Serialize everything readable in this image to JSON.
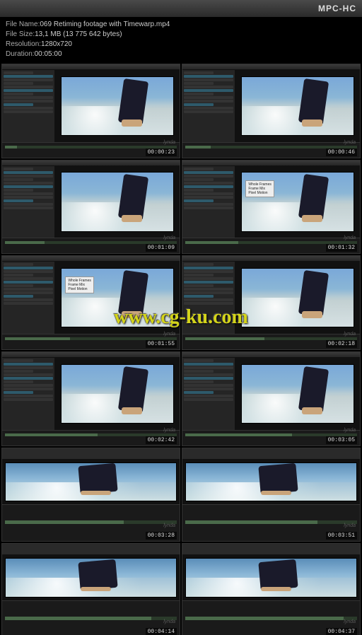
{
  "app_title": "MPC-HC",
  "file_info": {
    "name_label": "File Name: ",
    "name": "069 Retiming footage with Timewarp.mp4",
    "size_label": "File Size: ",
    "size": "13,1 MB (13 775 642 bytes)",
    "res_label": "Resolution: ",
    "res": "1280x720",
    "dur_label": "Duration: ",
    "dur": "00:05:00"
  },
  "watermark": "www.cg-ku.com",
  "lynda": "lynda",
  "popup_text": "Whole Frames\nFrame Mix\nPixel Motion",
  "thumbs": [
    {
      "tc": "00:00:23",
      "prog": 7,
      "layout": "split",
      "frame": 1,
      "popup": false
    },
    {
      "tc": "00:00:46",
      "prog": 15,
      "layout": "split",
      "frame": 1,
      "popup": false
    },
    {
      "tc": "00:01:09",
      "prog": 23,
      "layout": "split",
      "frame": 1,
      "popup": false
    },
    {
      "tc": "00:01:32",
      "prog": 31,
      "layout": "split",
      "frame": 1,
      "popup": true
    },
    {
      "tc": "00:01:55",
      "prog": 38,
      "layout": "split",
      "frame": 1,
      "popup": true
    },
    {
      "tc": "00:02:18",
      "prog": 46,
      "layout": "split",
      "frame": 1,
      "popup": false
    },
    {
      "tc": "00:02:42",
      "prog": 54,
      "layout": "split",
      "frame": 1,
      "popup": false
    },
    {
      "tc": "00:03:05",
      "prog": 62,
      "layout": "split",
      "frame": 1,
      "popup": false
    },
    {
      "tc": "00:03:28",
      "prog": 69,
      "layout": "full",
      "frame": 2,
      "popup": false
    },
    {
      "tc": "00:03:51",
      "prog": 77,
      "layout": "full",
      "frame": 2,
      "popup": false
    },
    {
      "tc": "00:04:14",
      "prog": 85,
      "layout": "full",
      "frame": 2,
      "popup": false
    },
    {
      "tc": "00:04:37",
      "prog": 92,
      "layout": "full",
      "frame": 2,
      "popup": false
    }
  ]
}
